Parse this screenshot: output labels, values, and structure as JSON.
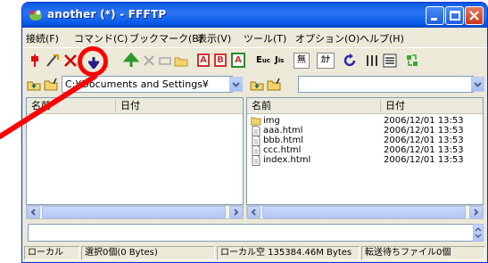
{
  "window": {
    "title": "another (*) - FFFTP"
  },
  "menu": [
    "接続(F)",
    "コマンド(C)",
    "ブックマーク(B)",
    "表示(V)",
    "ツール(T)",
    "オプション(O)",
    "ヘルプ(H)"
  ],
  "toolbar": {
    "labels": {
      "ascii": "A",
      "binary": "B",
      "ascii_bin": "A",
      "euc": "E",
      "jis": "J",
      "none": "無",
      "kana": "ｶﾅ"
    }
  },
  "local": {
    "path": "C:¥Documents and Settings¥",
    "columns": {
      "name": "名前",
      "date": "日付"
    }
  },
  "remote": {
    "path": "",
    "columns": {
      "name": "名前",
      "date": "日付"
    },
    "rows": [
      {
        "name": "img",
        "date": "2006/12/01 13:53",
        "icon": "folder-icon"
      },
      {
        "name": "aaa.html",
        "date": "2006/12/01 13:53",
        "icon": "file-icon"
      },
      {
        "name": "bbb.html",
        "date": "2006/12/01 13:53",
        "icon": "file-icon"
      },
      {
        "name": "ccc.html",
        "date": "2006/12/01 13:53",
        "icon": "file-icon"
      },
      {
        "name": "index.html",
        "date": "2006/12/01 13:53",
        "icon": "file-icon"
      }
    ]
  },
  "status": {
    "location": "ローカル",
    "selection": "選択0個(0 Bytes)",
    "free_space": "ローカル空 135384.46M Bytes",
    "queue": "転送待ちファイル0個"
  },
  "colors": {
    "highlight": "#ff0000",
    "title_bar": "#0a5ae0"
  }
}
